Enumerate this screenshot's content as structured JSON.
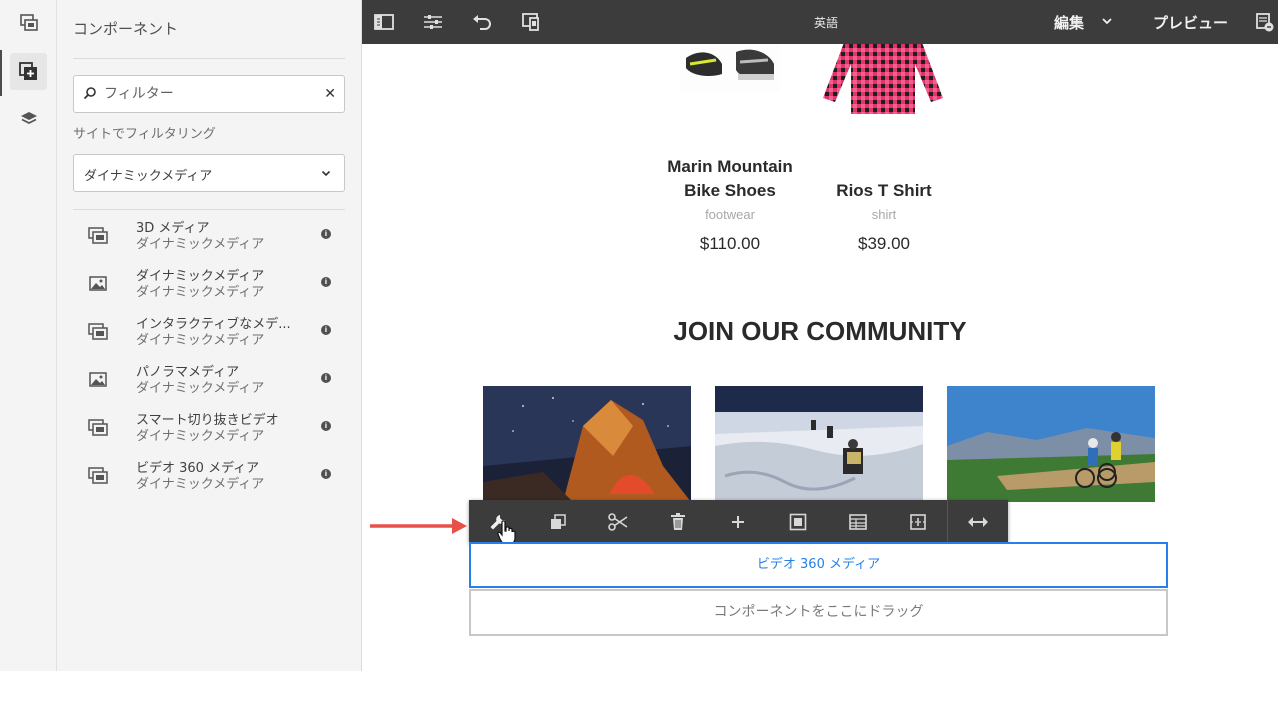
{
  "colors": {
    "toolbar_bg": "#3c3c3c",
    "selection_blue": "#2680eb",
    "annotation_red": "#e8504a",
    "panel_bg": "#f4f4f4"
  },
  "side_panel": {
    "title": "コンポーネント",
    "search": {
      "placeholder": "フィルター",
      "value": ""
    },
    "filter_label": "サイトでフィルタリング",
    "filter_select": {
      "selected": "ダイナミックメディア"
    },
    "components": [
      {
        "name": "3D メディア",
        "group": "ダイナミックメディア",
        "icon": "media-icon"
      },
      {
        "name": "ダイナミックメディア",
        "group": "ダイナミックメディア",
        "icon": "image-icon"
      },
      {
        "name": "インタラクティブなメデ...",
        "group": "ダイナミックメディア",
        "icon": "media-icon"
      },
      {
        "name": "パノラマメディア",
        "group": "ダイナミックメディア",
        "icon": "image-icon"
      },
      {
        "name": "スマート切り抜きビデオ",
        "group": "ダイナミックメディア",
        "icon": "media-icon"
      },
      {
        "name": "ビデオ 360 メディア",
        "group": "ダイナミックメディア",
        "icon": "media-icon"
      }
    ]
  },
  "topbar": {
    "language": "英語",
    "mode": "編集",
    "preview": "プレビュー"
  },
  "page": {
    "products": [
      {
        "name_line1": "Marin Mountain",
        "name_line2": "Bike Shoes",
        "category": "footwear",
        "price": "$110.00"
      },
      {
        "name_line1": "",
        "name_line2": "Rios T Shirt",
        "category": "shirt",
        "price": "$39.00"
      }
    ],
    "community_heading": "JOIN OUR COMMUNITY",
    "selected_component_label": "ビデオ 360 メディア",
    "dropzone_label": "コンポーネントをここにドラッグ"
  }
}
